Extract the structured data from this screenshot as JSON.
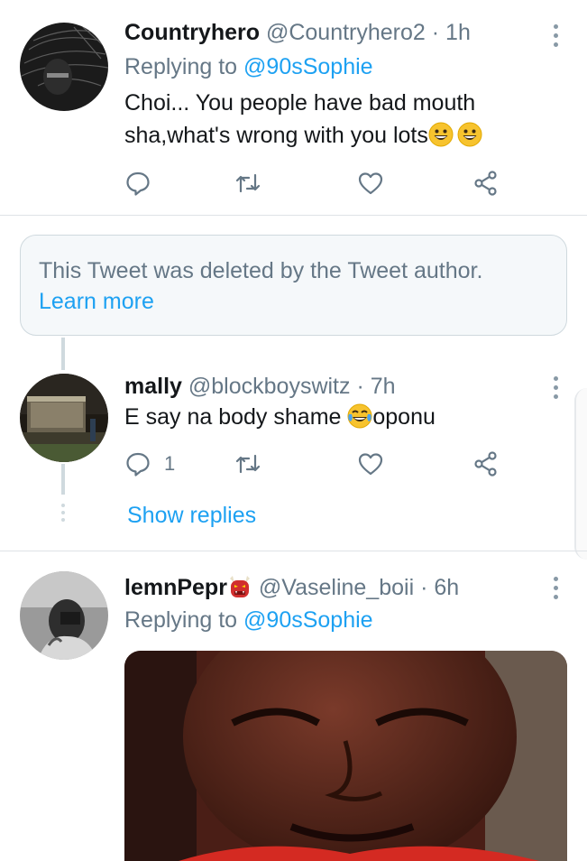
{
  "colors": {
    "accent": "#1da1f2",
    "muted": "#657786",
    "text": "#14171a",
    "divider": "#dfe3e7"
  },
  "tweets": [
    {
      "name": "Countryhero",
      "handle": "@Countryhero2",
      "separator": "·",
      "time": "1h",
      "replying_prefix": "Replying to ",
      "replying_to": "@90sSophie",
      "text_line1": "Choi... You people have bad mouth",
      "text_line2": "sha,what's wrong with you lots",
      "emoji": [
        "grinning-face",
        "grinning-face"
      ]
    },
    {
      "name": "mally",
      "handle": "@blockboyswitz",
      "separator": "·",
      "time": "7h",
      "text_before_emoji": "E say na body shame ",
      "emoji": "crying-laughing-face",
      "text_after_emoji": "oponu",
      "reply_count": "1",
      "show_replies": "Show replies"
    },
    {
      "name": "lemnPepr",
      "name_emoji": "ogre-mask",
      "handle": "@Vaseline_boii",
      "separator": "·",
      "time": "6h",
      "replying_prefix": "Replying to ",
      "replying_to": "@90sSophie"
    }
  ],
  "deleted_notice": {
    "message": "This Tweet was deleted by the Tweet author.",
    "link": "Learn more"
  },
  "icons": {
    "reply": "reply-icon",
    "retweet": "retweet-icon",
    "like": "heart-icon",
    "share": "share-icon",
    "more": "more-vertical-icon"
  }
}
